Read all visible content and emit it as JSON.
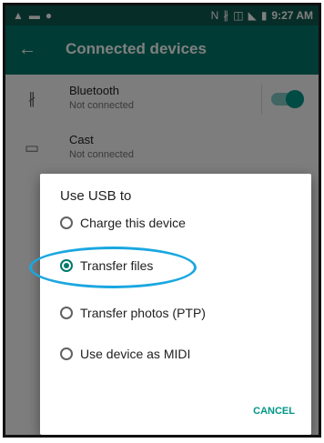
{
  "status_bar": {
    "time": "9:27 AM",
    "left_icons": [
      "warning-icon",
      "image-icon",
      "circle-icon"
    ],
    "right_icons": [
      "nfc-icon",
      "bluetooth-icon",
      "vibrate-icon",
      "signal-icon",
      "battery-icon"
    ]
  },
  "toolbar": {
    "title": "Connected devices"
  },
  "settings": {
    "items": [
      {
        "title": "Bluetooth",
        "subtitle": "Not connected",
        "icon": "bluetooth-icon",
        "toggle_on": true
      },
      {
        "title": "Cast",
        "subtitle": "Not connected",
        "icon": "cast-icon"
      }
    ]
  },
  "dialog": {
    "title": "Use USB to",
    "options": [
      {
        "label": "Charge this device",
        "selected": false
      },
      {
        "label": "Transfer files",
        "selected": true
      },
      {
        "label": "Transfer photos (PTP)",
        "selected": false
      },
      {
        "label": "Use device as MIDI",
        "selected": false
      }
    ],
    "cancel_label": "CANCEL"
  },
  "colors": {
    "status_bar": "#0e5a50",
    "toolbar": "#00796b",
    "accent": "#009688",
    "highlight": "#1aa7e0"
  }
}
